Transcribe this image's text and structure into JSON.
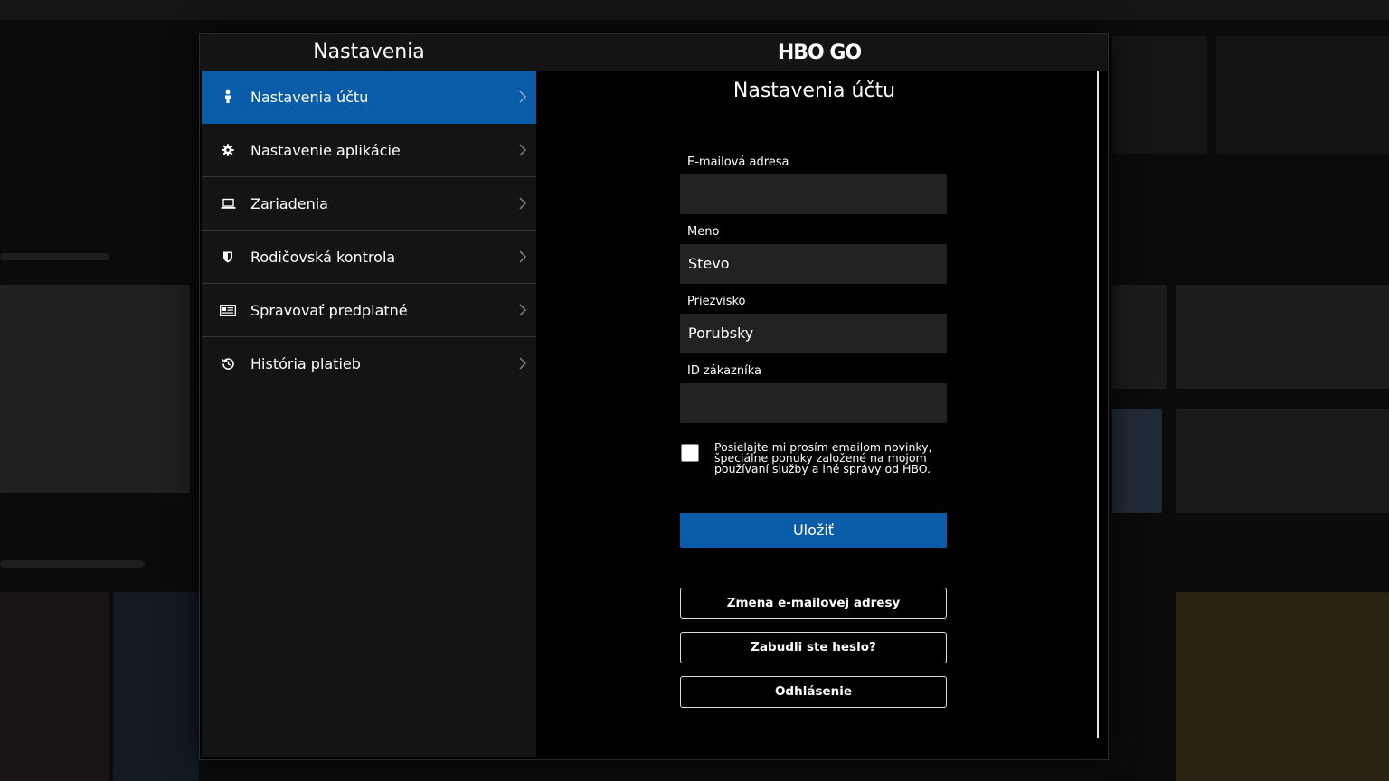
{
  "modal": {
    "sidebar_title": "Nastavenia",
    "logo_text": "HBO GO"
  },
  "sidebar": {
    "items": [
      {
        "label": "Nastavenia účtu",
        "icon": "person-icon",
        "active": true
      },
      {
        "label": "Nastavenie aplikácie",
        "icon": "gear-icon",
        "active": false
      },
      {
        "label": "Zariadenia",
        "icon": "laptop-icon",
        "active": false
      },
      {
        "label": "Rodičovská kontrola",
        "icon": "shield-icon",
        "active": false
      },
      {
        "label": "Spravovať predplatné",
        "icon": "subscription-icon",
        "active": false
      },
      {
        "label": "História platieb",
        "icon": "history-icon",
        "active": false
      }
    ]
  },
  "account": {
    "title": "Nastavenia účtu",
    "email_label": "E-mailová adresa",
    "email_value": "",
    "first_name_label": "Meno",
    "first_name_value": "Stevo",
    "last_name_label": "Priezvisko",
    "last_name_value": "Porubsky",
    "customer_id_label": "ID zákazníka",
    "customer_id_value": "",
    "newsletter_text": "Posielajte mi prosím emailom novinky, špeciálne ponuky založené na mojom používaní služby a iné správy od HBO.",
    "newsletter_checked": false,
    "save_label": "Uložiť",
    "change_email_label": "Zmena e-mailovej adresy",
    "forgot_password_label": "Zabudli ste heslo?",
    "logout_label": "Odhlásenie"
  },
  "colors": {
    "accent": "#0b5ca8",
    "panel": "#141414",
    "field": "#222222",
    "background": "#000000"
  }
}
